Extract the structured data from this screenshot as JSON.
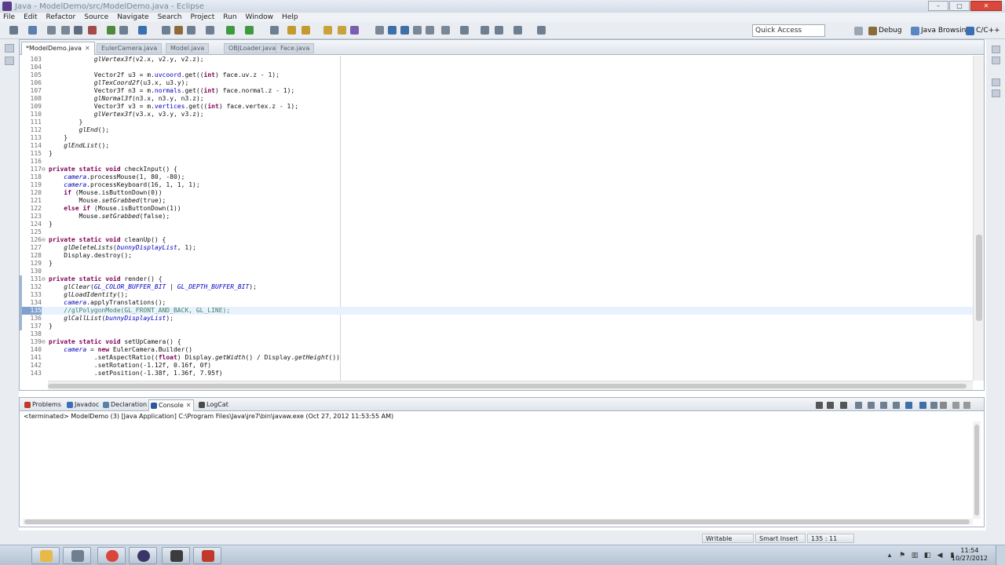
{
  "window": {
    "title": "Java - ModelDemo/src/ModelDemo.java - Eclipse"
  },
  "menu": [
    "File",
    "Edit",
    "Refactor",
    "Source",
    "Navigate",
    "Search",
    "Project",
    "Run",
    "Window",
    "Help"
  ],
  "toolbar": {
    "quick_access": "Quick Access",
    "perspectives": [
      "Debug",
      "Java Browsing",
      "C/C++"
    ]
  },
  "editor": {
    "tabs": [
      {
        "label": "*ModelDemo.java",
        "active": true
      },
      {
        "label": "EulerCamera.java",
        "active": false
      },
      {
        "label": "Model.java",
        "active": false
      },
      {
        "label": "OBJLoader.java",
        "active": false
      },
      {
        "label": "Face.java",
        "active": false
      }
    ],
    "current_line": 135,
    "lines": [
      {
        "n": "103",
        "fold": "",
        "text": "            glVertex3f(v2.x, v2.y, v2.z);"
      },
      {
        "n": "104",
        "fold": "",
        "text": ""
      },
      {
        "n": "105",
        "fold": "",
        "text": "            Vector2f u3 = m.uvcoord.get((int) face.uv.z - 1);"
      },
      {
        "n": "106",
        "fold": "",
        "text": "            glTexCoord2f(u3.x, u3.y);"
      },
      {
        "n": "107",
        "fold": "",
        "text": "            Vector3f n3 = m.normals.get((int) face.normal.z - 1);"
      },
      {
        "n": "108",
        "fold": "",
        "text": "            glNormal3f(n3.x, n3.y, n3.z);"
      },
      {
        "n": "109",
        "fold": "",
        "text": "            Vector3f v3 = m.vertices.get((int) face.vertex.z - 1);"
      },
      {
        "n": "110",
        "fold": "",
        "text": "            glVertex3f(v3.x, v3.y, v3.z);"
      },
      {
        "n": "111",
        "fold": "",
        "text": "        }"
      },
      {
        "n": "112",
        "fold": "",
        "text": "        glEnd();"
      },
      {
        "n": "113",
        "fold": "",
        "text": "    }"
      },
      {
        "n": "114",
        "fold": "",
        "text": "    glEndList();"
      },
      {
        "n": "115",
        "fold": "",
        "text": "}"
      },
      {
        "n": "116",
        "fold": "",
        "text": ""
      },
      {
        "n": "117",
        "fold": "⊖",
        "text": "private static void checkInput() {"
      },
      {
        "n": "118",
        "fold": "",
        "text": "    camera.processMouse(1, 80, -80);"
      },
      {
        "n": "119",
        "fold": "",
        "text": "    camera.processKeyboard(16, 1, 1, 1);"
      },
      {
        "n": "120",
        "fold": "",
        "text": "    if (Mouse.isButtonDown(0))"
      },
      {
        "n": "121",
        "fold": "",
        "text": "        Mouse.setGrabbed(true);"
      },
      {
        "n": "122",
        "fold": "",
        "text": "    else if (Mouse.isButtonDown(1))"
      },
      {
        "n": "123",
        "fold": "",
        "text": "        Mouse.setGrabbed(false);"
      },
      {
        "n": "124",
        "fold": "",
        "text": "}"
      },
      {
        "n": "125",
        "fold": "",
        "text": ""
      },
      {
        "n": "126",
        "fold": "⊖",
        "text": "private static void cleanUp() {"
      },
      {
        "n": "127",
        "fold": "",
        "text": "    glDeleteLists(bunnyDisplayList, 1);"
      },
      {
        "n": "128",
        "fold": "",
        "text": "    Display.destroy();"
      },
      {
        "n": "129",
        "fold": "",
        "text": "}"
      },
      {
        "n": "130",
        "fold": "",
        "text": ""
      },
      {
        "n": "131",
        "fold": "⊖",
        "text": "private static void render() {"
      },
      {
        "n": "132",
        "fold": "",
        "text": "    glClear(GL_COLOR_BUFFER_BIT | GL_DEPTH_BUFFER_BIT);"
      },
      {
        "n": "133",
        "fold": "",
        "text": "    glLoadIdentity();"
      },
      {
        "n": "134",
        "fold": "",
        "text": "    camera.applyTranslations();"
      },
      {
        "n": "135",
        "fold": "",
        "text": "    //glPolygonMode(GL_FRONT_AND_BACK, GL_LINE);"
      },
      {
        "n": "136",
        "fold": "",
        "text": "    glCallList(bunnyDisplayList);"
      },
      {
        "n": "137",
        "fold": "",
        "text": "}"
      },
      {
        "n": "138",
        "fold": "",
        "text": ""
      },
      {
        "n": "139",
        "fold": "⊖",
        "text": "private static void setUpCamera() {"
      },
      {
        "n": "140",
        "fold": "",
        "text": "    camera = new EulerCamera.Builder()"
      },
      {
        "n": "141",
        "fold": "",
        "text": "            .setAspectRatio((float) Display.getWidth() / Display.getHeight())"
      },
      {
        "n": "142",
        "fold": "",
        "text": "            .setRotation(-1.12f, 0.16f, 0f)"
      },
      {
        "n": "143",
        "fold": "",
        "text": "            .setPosition(-1.38f, 1.36f, 7.95f)"
      }
    ]
  },
  "console": {
    "tabs": [
      {
        "label": "Problems",
        "active": false,
        "color": "#c0392b"
      },
      {
        "label": "Javadoc",
        "active": false,
        "color": "#3b6fb6"
      },
      {
        "label": "Declaration",
        "active": false,
        "color": "#5b7fa8"
      },
      {
        "label": "Console",
        "active": true,
        "color": "#2c5aa0"
      },
      {
        "label": "LogCat",
        "active": false,
        "color": "#4a4a4a"
      }
    ],
    "status_line": "<terminated> ModelDemo (3) [Java Application] C:\\Program Files\\Java\\jre7\\bin\\javaw.exe (Oct 27, 2012 11:53:55 AM)"
  },
  "statusbar": {
    "writable": "Writable",
    "insert_mode": "Smart Insert",
    "position": "135 : 11"
  },
  "taskbar": {
    "time": "11:54",
    "date": "10/27/2012"
  },
  "colors": {
    "keyword": "#7f0055",
    "field": "#0000c0",
    "comment": "#3f7f5f",
    "accent": "#7da0cf"
  }
}
